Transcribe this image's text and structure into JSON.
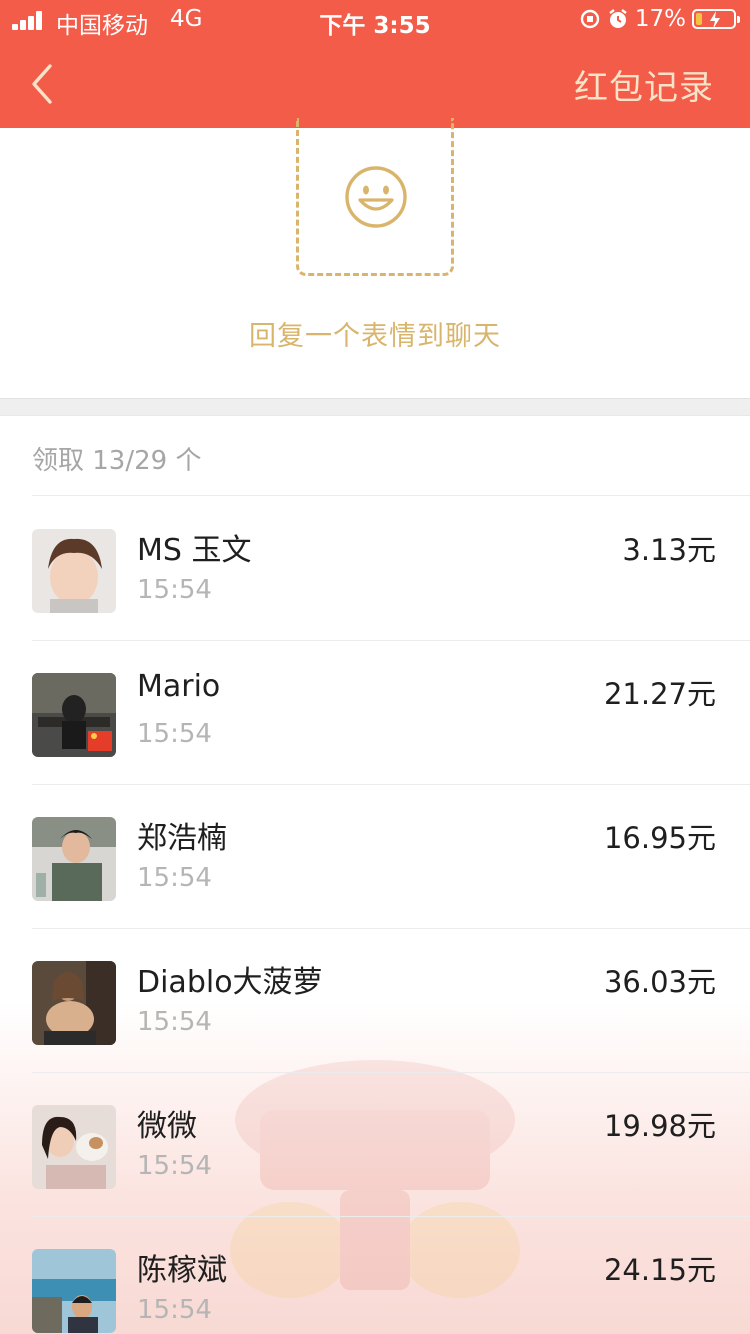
{
  "status_bar": {
    "carrier": "中国移动",
    "network": "4G",
    "time": "下午 3:55",
    "battery_percent": "17%",
    "battery_level": 0.17
  },
  "nav": {
    "title": "红包记录",
    "back_icon": "chevron-left-icon"
  },
  "header": {
    "reply_hint": "回复一个表情到聊天"
  },
  "claim_summary": "领取 13/29 个",
  "records": [
    {
      "name": "MS 玉文",
      "time": "15:54",
      "amount": "3.13元"
    },
    {
      "name": "Mario",
      "time": "15:54",
      "amount": "21.27元"
    },
    {
      "name": "郑浩楠",
      "time": "15:54",
      "amount": "16.95元"
    },
    {
      "name": "Diablo大菠萝",
      "time": "15:54",
      "amount": "36.03元"
    },
    {
      "name": "微微",
      "time": "15:54",
      "amount": "19.98元"
    },
    {
      "name": "陈稼斌",
      "time": "15:54",
      "amount": "24.15元"
    }
  ],
  "colors": {
    "header_red": "#f25c49",
    "title_cream": "#f9e2c8",
    "accent_gold": "#d9b56c"
  }
}
